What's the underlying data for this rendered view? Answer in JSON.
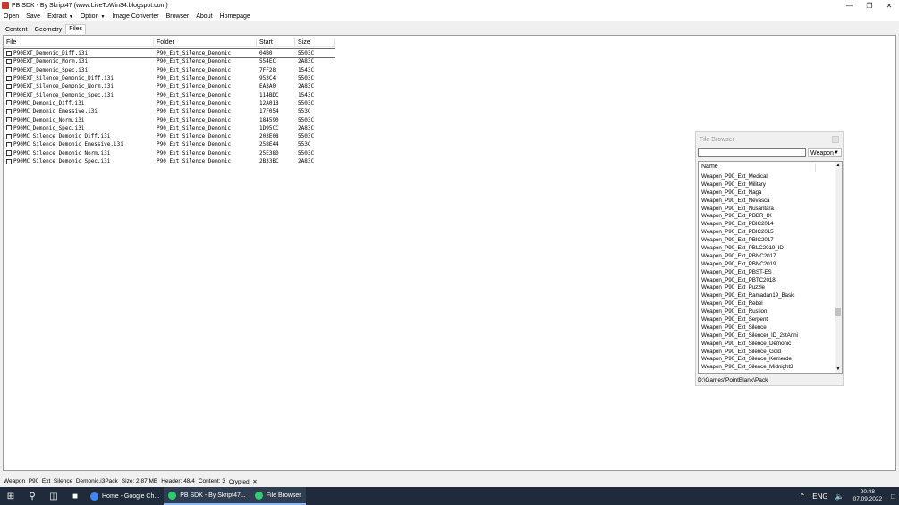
{
  "window": {
    "title": "PB SDK - By Skript47 (www.LiveToWin34.blogspot.com)"
  },
  "menu": {
    "items": [
      "Open",
      "Save",
      "Extract",
      "Option",
      "Image Converter",
      "Browser",
      "About",
      "Homepage"
    ]
  },
  "tabs": [
    "Content",
    "Geometry",
    "Files"
  ],
  "active_tab": "Files",
  "table": {
    "headers": [
      "File",
      "Folder",
      "Start",
      "Size"
    ],
    "rows": [
      {
        "file": "P90EXT_Demonic_Diff.i3i",
        "folder": "P90_Ext_Silence_Demonic",
        "start": "04B0",
        "size": "5503C",
        "selected": true
      },
      {
        "file": "P90EXT_Demonic_Norm.i3i",
        "folder": "P90_Ext_Silence_Demonic",
        "start": "554EC",
        "size": "2A83C"
      },
      {
        "file": "P90EXT_Demonic_Spec.i3i",
        "folder": "P90_Ext_Silence_Demonic",
        "start": "7FF28",
        "size": "1543C"
      },
      {
        "file": "P90EXT_Silence_Demonic_Diff.i3i",
        "folder": "P90_Ext_Silence_Demonic",
        "start": "953C4",
        "size": "5503C"
      },
      {
        "file": "P90EXT_Silence_Demonic_Norm.i3i",
        "folder": "P90_Ext_Silence_Demonic",
        "start": "EA3A0",
        "size": "2A83C"
      },
      {
        "file": "P90EXT_Silence_Demonic_Spec.i3i",
        "folder": "P90_Ext_Silence_Demonic",
        "start": "114BDC",
        "size": "1543C"
      },
      {
        "file": "P90MC_Demonic_Diff.i3i",
        "folder": "P90_Ext_Silence_Demonic",
        "start": "12A018",
        "size": "5503C"
      },
      {
        "file": "P90MC_Demonic_Emessive.i3i",
        "folder": "P90_Ext_Silence_Demonic",
        "start": "17F054",
        "size": "553C"
      },
      {
        "file": "P90MC_Demonic_Norm.i3i",
        "folder": "P90_Ext_Silence_Demonic",
        "start": "184590",
        "size": "5503C"
      },
      {
        "file": "P90MC_Demonic_Spec.i3i",
        "folder": "P90_Ext_Silence_Demonic",
        "start": "1D95CC",
        "size": "2A83C"
      },
      {
        "file": "P90MC_Silence_Demonic_Diff.i3i",
        "folder": "P90_Ext_Silence_Demonic",
        "start": "203E08",
        "size": "5503C"
      },
      {
        "file": "P90MC_Silence_Demonic_Emessive.i3i",
        "folder": "P90_Ext_Silence_Demonic",
        "start": "258E44",
        "size": "553C"
      },
      {
        "file": "P90MC_Silence_Demonic_Norm.i3i",
        "folder": "P90_Ext_Silence_Demonic",
        "start": "25E380",
        "size": "5503C"
      },
      {
        "file": "P90MC_Silence_Demonic_Spec.i3i",
        "folder": "P90_Ext_Silence_Demonic",
        "start": "2B33BC",
        "size": "2A83C"
      }
    ]
  },
  "file_browser": {
    "title": "File Browser",
    "search_value": "",
    "combo_value": "Weapon",
    "column_header": "Name",
    "items": [
      "Weapon_P90_Ext_Medical",
      "Weapon_P90_Ext_Military",
      "Weapon_P90_Ext_Naga",
      "Weapon_P90_Ext_Nevasca",
      "Weapon_P90_Ext_Nusantara",
      "Weapon_P90_Ext_PBBR_IX",
      "Weapon_P90_Ext_PBIC2014",
      "Weapon_P90_Ext_PBIC2015",
      "Weapon_P90_Ext_PBIC2017",
      "Weapon_P90_Ext_PBLC2019_ID",
      "Weapon_P90_Ext_PBNC2017",
      "Weapon_P90_Ext_PBNC2019",
      "Weapon_P90_Ext_PBST-ES",
      "Weapon_P90_Ext_PBTC2018",
      "Weapon_P90_Ext_Puzzle",
      "Weapon_P90_Ext_Ramadan19_Basic",
      "Weapon_P90_Ext_Rebel",
      "Weapon_P90_Ext_Rustion",
      "Weapon_P90_Ext_Serpent",
      "Weapon_P90_Ext_Silence",
      "Weapon_P90_Ext_Silencer_ID_2stAnni",
      "Weapon_P90_Ext_Silence_Demonic",
      "Weapon_P90_Ext_Silence_Gold",
      "Weapon_P90_Ext_Silence_Kemerde",
      "Weapon_P90_Ext_Silence_Midnight3"
    ],
    "path": "D:\\Games\\PointBlank\\Pack"
  },
  "status": {
    "file": "Weapon_P90_Ext_Silence_Demonic.i3Pack",
    "size": "Size: 2.87 MB",
    "header": "Header: 48/4",
    "content": "Content: 3",
    "crypted": "Crypted: ✕"
  },
  "taskbar": {
    "apps": [
      {
        "label": "Home - Google Ch...",
        "color": "#4285f4",
        "open": false
      },
      {
        "label": "PB SDK - By Skript47...",
        "color": "#2ecc71",
        "open": true
      },
      {
        "label": "File Browser",
        "color": "#2ecc71",
        "open": true
      }
    ],
    "lang": "ENG",
    "time": "20:48",
    "date": "07.09.2022"
  }
}
